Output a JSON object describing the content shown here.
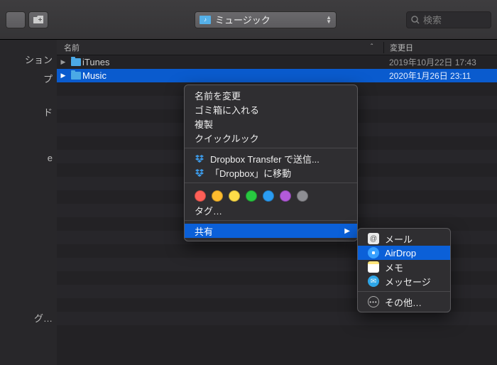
{
  "toolbar": {
    "path_label": "ミュージック",
    "search_placeholder": "検索"
  },
  "sidebar": {
    "items": [
      "ション",
      "プ",
      "ド",
      "e",
      "グ…"
    ]
  },
  "columns": {
    "name": "名前",
    "modified": "変更日"
  },
  "rows": [
    {
      "name": "iTunes",
      "date": "2019年10月22日 17:43",
      "selected": false
    },
    {
      "name": "Music",
      "date": "2020年1月26日 23:11",
      "selected": true
    }
  ],
  "context_menu": {
    "rename": "名前を変更",
    "trash": "ゴミ箱に入れる",
    "duplicate": "複製",
    "quicklook": "クイックルック",
    "dropbox_transfer": "Dropbox Transfer で送信...",
    "dropbox_move": "「Dropbox」に移動",
    "tags_label": "タグ…",
    "share": "共有",
    "tag_colors": [
      "#ff5f57",
      "#febc2e",
      "#fddc48",
      "#28c840",
      "#2b9cf2",
      "#b25ad9",
      "#8e8e93"
    ]
  },
  "share_submenu": {
    "mail": "メール",
    "airdrop": "AirDrop",
    "notes": "メモ",
    "messages": "メッセージ",
    "more": "その他…"
  }
}
